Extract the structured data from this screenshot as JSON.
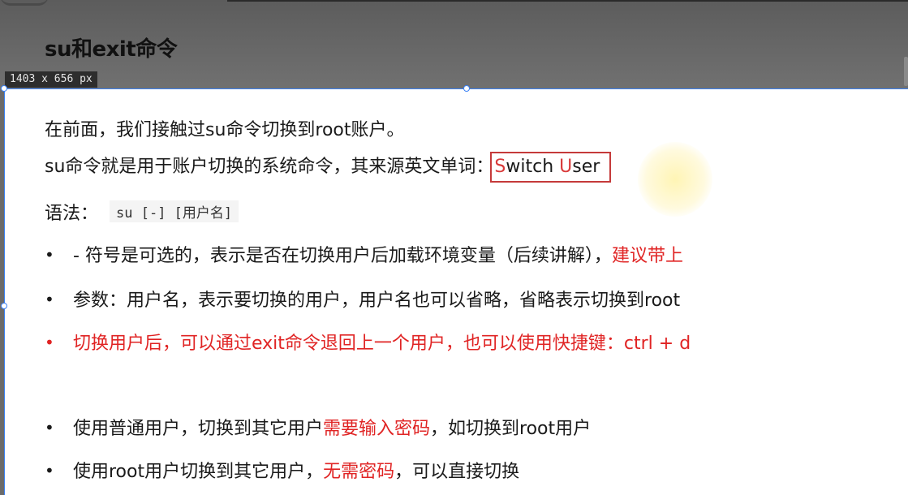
{
  "slide": {
    "title": "su和exit命令",
    "size_badge": "1403 x 656  px"
  },
  "content": {
    "intro": "在前面，我们接触过su命令切换到root账户。",
    "desc_prefix": "su命令就是用于账户切换的系统命令，其来源英文单词：",
    "desc_s": "S",
    "desc_mid": "witch ",
    "desc_u": "U",
    "desc_end": "ser",
    "syntax_label": "语法：",
    "syntax_code": "su [-] [用户名]",
    "bullets": [
      {
        "marker": "•",
        "text": "- 符号是可选的，表示是否在切换用户后加载环境变量（后续讲解），",
        "highlight": "建议带上"
      },
      {
        "marker": "•",
        "text": "参数：用户名，表示要切换的用户，用户名也可以省略，省略表示切换到root",
        "highlight": ""
      },
      {
        "marker": "•",
        "text": "切换用户后，可以通过exit命令退回上一个用户，也可以使用快捷键：ctrl + d",
        "highlight": ""
      },
      {
        "marker": "•",
        "text": "使用普通用户，切换到其它用户",
        "highlight": "需要输入密码",
        "suffix": "，如切换到root用户"
      },
      {
        "marker": "•",
        "text": "使用root用户切换到其它用户，",
        "highlight": "无需密码",
        "suffix": "，可以直接切换"
      }
    ]
  },
  "colors": {
    "accent_red": "#e02424",
    "selection_blue": "#3b82f6"
  }
}
